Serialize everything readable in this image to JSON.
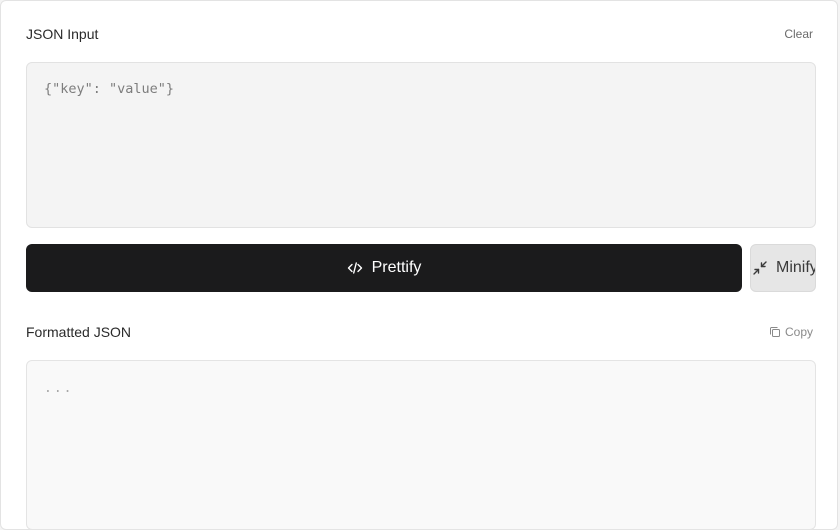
{
  "input_section": {
    "label": "JSON Input",
    "clear_label": "Clear",
    "placeholder": "{\"key\": \"value\"}",
    "value": ""
  },
  "actions": {
    "prettify_label": "Prettify",
    "prettify_icon": "code-icon",
    "minify_label": "Minify",
    "minify_icon": "minimize-icon"
  },
  "output_section": {
    "label": "Formatted JSON",
    "copy_label": "Copy",
    "copy_icon": "copy-icon",
    "placeholder": "..."
  },
  "colors": {
    "primary_button": "#1b1b1c",
    "secondary_button": "#e6e6e6",
    "input_bg": "#f4f4f4",
    "output_bg": "#f9f9f9"
  }
}
